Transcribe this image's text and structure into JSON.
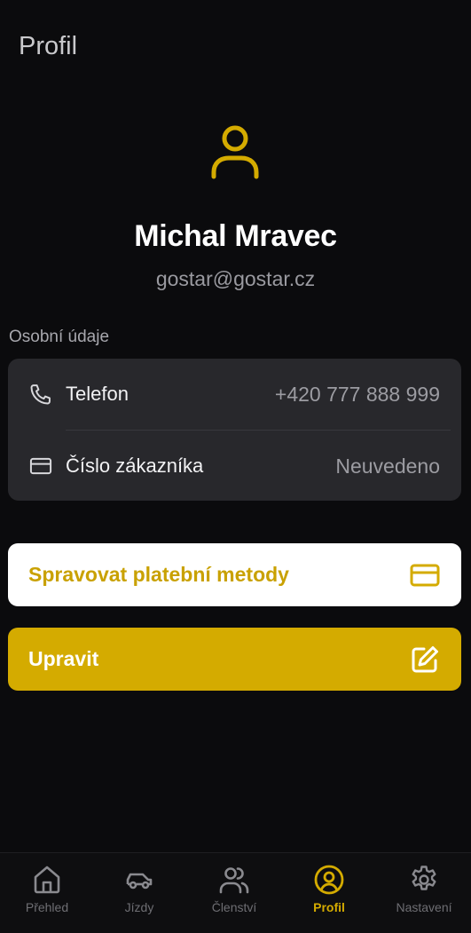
{
  "header": {
    "title": "Profil"
  },
  "profile": {
    "icon": "user-icon",
    "name": "Michal Mravec",
    "email": "gostar@gostar.cz"
  },
  "personal": {
    "section_label": "Osobní údaje",
    "rows": [
      {
        "icon": "phone-icon",
        "label": "Telefon",
        "value": "+420 777 888 999"
      },
      {
        "icon": "card-icon",
        "label": "Číslo zákazníka",
        "value": "Neuvedeno"
      }
    ]
  },
  "actions": {
    "payment": {
      "label": "Spravovat platební metody",
      "icon": "credit-card-icon"
    },
    "edit": {
      "label": "Upravit",
      "icon": "edit-icon"
    }
  },
  "nav": {
    "items": [
      {
        "label": "Přehled",
        "icon": "home-icon",
        "active": false
      },
      {
        "label": "Jízdy",
        "icon": "car-icon",
        "active": false
      },
      {
        "label": "Členství",
        "icon": "users-icon",
        "active": false
      },
      {
        "label": "Profil",
        "icon": "user-circle-icon",
        "active": true
      },
      {
        "label": "Nastavení",
        "icon": "gear-icon",
        "active": false
      }
    ]
  },
  "colors": {
    "background": "#0b0b0d",
    "accent": "#d4ab00",
    "card": "#28282c",
    "muted": "#6e6e73"
  }
}
